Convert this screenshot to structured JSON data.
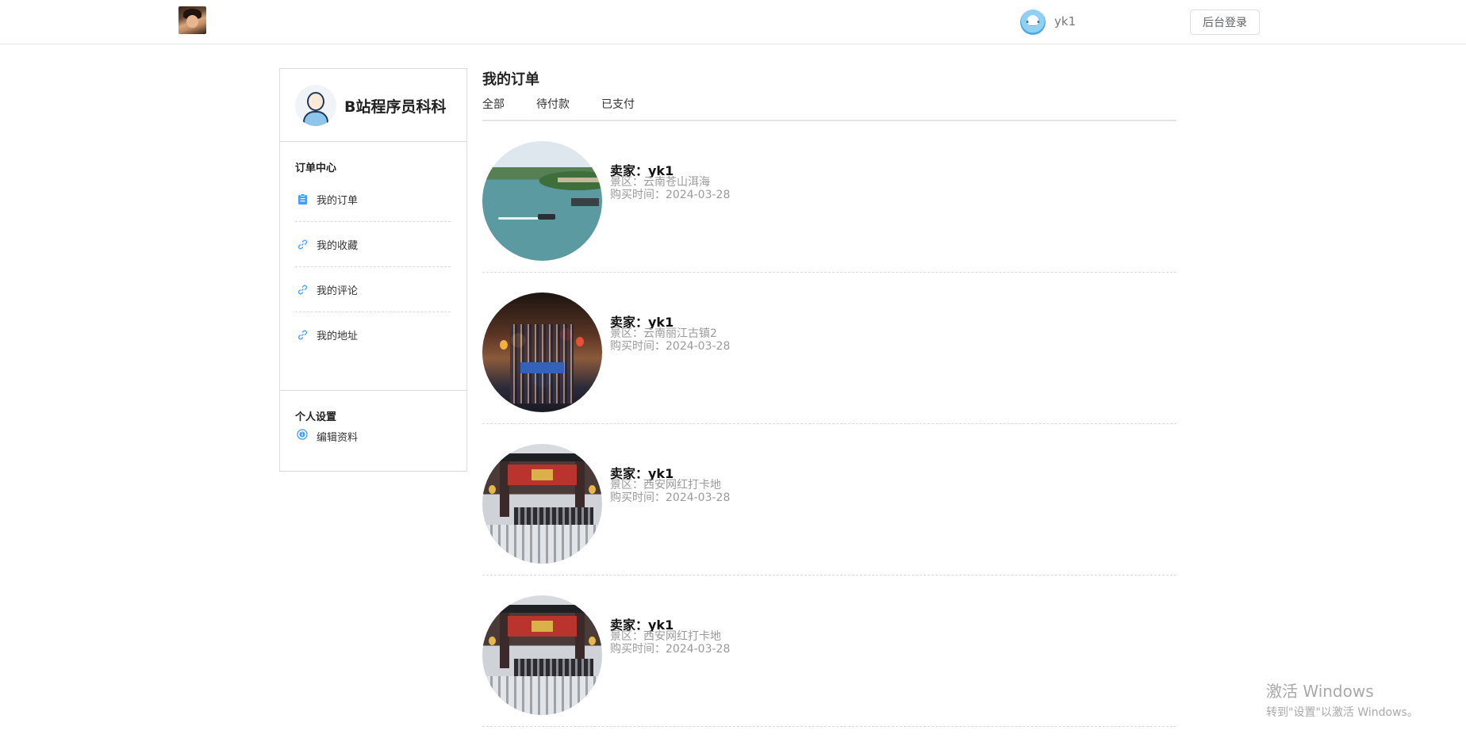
{
  "header": {
    "user_name": "yk1",
    "admin_login": "后台登录"
  },
  "sidebar": {
    "profile_name": "B站程序员科科",
    "order_center_title": "订单中心",
    "order_items": [
      {
        "label": "我的订单",
        "icon": "clipboard-icon"
      },
      {
        "label": "我的收藏",
        "icon": "link-icon"
      },
      {
        "label": "我的评论",
        "icon": "link-icon"
      },
      {
        "label": "我的地址",
        "icon": "link-icon"
      }
    ],
    "settings_title": "个人设置",
    "settings_items": [
      {
        "label": "编辑资料",
        "icon": "info-icon"
      }
    ]
  },
  "main": {
    "title": "我的订单",
    "tabs": [
      "全部",
      "待付款",
      "已支付"
    ],
    "orders": [
      {
        "seller": "卖家：yk1",
        "scenic": "景区：云南苍山洱海",
        "time": "购买时间：2024-03-28",
        "image": "lake"
      },
      {
        "seller": "卖家：yk1",
        "scenic": "景区：云南丽江古镇2",
        "time": "购买时间：2024-03-28",
        "image": "street"
      },
      {
        "seller": "卖家：yk1",
        "scenic": "景区：西安网红打卡地",
        "time": "购买时间：2024-03-28",
        "image": "gate"
      },
      {
        "seller": "卖家：yk1",
        "scenic": "景区：西安网红打卡地",
        "time": "购买时间：2024-03-28",
        "image": "gate"
      }
    ]
  },
  "watermark": {
    "line1": "激活 Windows",
    "line2": "转到\"设置\"以激活 Windows。"
  },
  "colors": {
    "accent": "#409eff",
    "border": "#dcdcdc"
  }
}
